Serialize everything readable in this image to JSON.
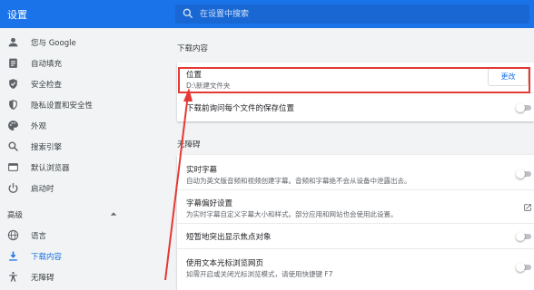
{
  "header": {
    "title": "设置",
    "search_placeholder": "在设置中搜索"
  },
  "sidebar": {
    "items": [
      {
        "label": "您与 Google",
        "icon": "person-icon"
      },
      {
        "label": "自动填充",
        "icon": "clipboard-icon"
      },
      {
        "label": "安全检查",
        "icon": "shield-check-icon"
      },
      {
        "label": "隐私设置和安全性",
        "icon": "privacy-shield-icon"
      },
      {
        "label": "外观",
        "icon": "palette-icon"
      },
      {
        "label": "搜索引擎",
        "icon": "search-icon"
      },
      {
        "label": "默认浏览器",
        "icon": "browser-icon"
      },
      {
        "label": "启动时",
        "icon": "power-icon"
      }
    ],
    "advanced_label": "高级",
    "advanced_items": [
      {
        "label": "语言",
        "icon": "globe-icon"
      },
      {
        "label": "下载内容",
        "icon": "download-icon",
        "active": true
      },
      {
        "label": "无障碍",
        "icon": "accessibility-icon"
      }
    ]
  },
  "downloads": {
    "section_title": "下载内容",
    "location_label": "位置",
    "location_value": "D:\\新建文件夹",
    "change_button": "更改",
    "ask_label": "下载前询问每个文件的保存位置",
    "ask_enabled": false
  },
  "accessibility": {
    "section_title": "无障碍",
    "items": [
      {
        "label": "实时字幕",
        "sub": "自动为英文版音频和视频创建字幕。音频和字幕绝不会从设备中泄露出去。",
        "control": "toggle",
        "enabled": false
      },
      {
        "label": "字幕偏好设置",
        "sub": "为实时字幕自定义字幕大小和样式。部分应用和网站也会使用此设置。",
        "control": "external-link-icon"
      },
      {
        "label": "短暂地突出显示焦点对象",
        "sub": "",
        "control": "toggle",
        "enabled": false
      },
      {
        "label": "使用文本光标浏览网页",
        "sub": "如需开启或关闭光标浏览模式，请使用快捷键 F7",
        "control": "toggle",
        "enabled": false
      }
    ]
  },
  "colors": {
    "accent": "#1a73e8",
    "annotation": "#e53935"
  }
}
